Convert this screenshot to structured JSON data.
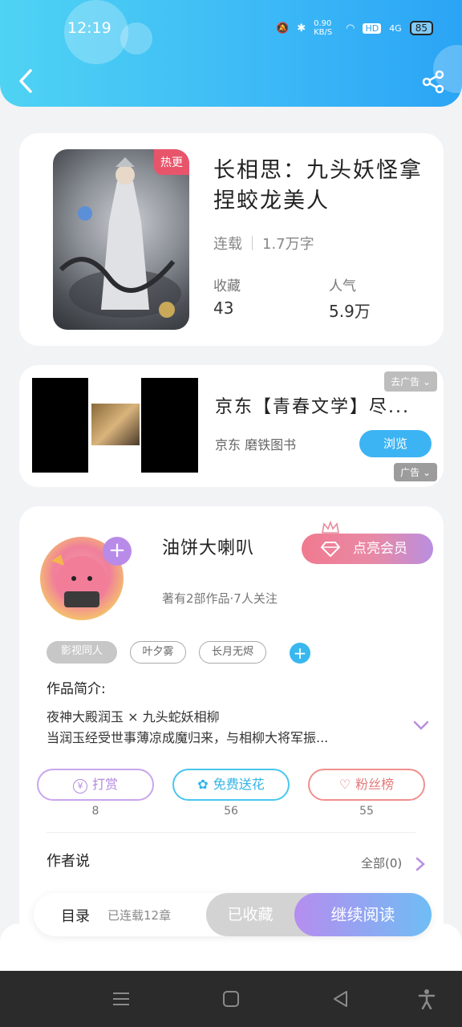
{
  "status_bar": {
    "time": "12:19",
    "speed": "0.90 KB/S",
    "network": "4G",
    "hd": "HD",
    "battery": "85"
  },
  "header": {
    "back_icon": "chevron-left-icon",
    "share_icon": "share-icon"
  },
  "book": {
    "hot_badge": "热更",
    "title": "长相思：九头妖怪拿捏蛟龙美人",
    "status": "连载",
    "word_count": "1.7万字",
    "favorites_label": "收藏",
    "favorites_value": "43",
    "popularity_label": "人气",
    "popularity_value": "5.9万"
  },
  "ad": {
    "close_tag": "去广告",
    "title": "京东【青春文学】尽...",
    "source": "京东 磨铁图书",
    "browse_label": "浏览",
    "ad_label": "广告"
  },
  "author": {
    "name": "油饼大喇叭",
    "info": "著有2部作品·7人关注",
    "vip_label": "点亮会员",
    "tags": [
      "影视同人",
      "叶夕雾",
      "长月无烬"
    ],
    "intro_label": "作品简介:",
    "intro_line1": "夜神大殿润玉 × 九头蛇妖相柳",
    "intro_line2": "当润玉经受世事薄凉成魔归来，与相柳大将军振...",
    "actions": [
      {
        "label": "打赏",
        "count": "8",
        "color": "#c8a6ec"
      },
      {
        "label": "免费送花",
        "count": "56",
        "color": "#49c6ee"
      },
      {
        "label": "粉丝榜",
        "count": "55",
        "color": "#f0908e"
      }
    ],
    "author_says": "作者说",
    "all_link": "全部(0)"
  },
  "bottom_bar": {
    "toc_label": "目录",
    "toc_status": "已连载12章",
    "fav_label": "已收藏",
    "read_label": "继续阅读"
  }
}
